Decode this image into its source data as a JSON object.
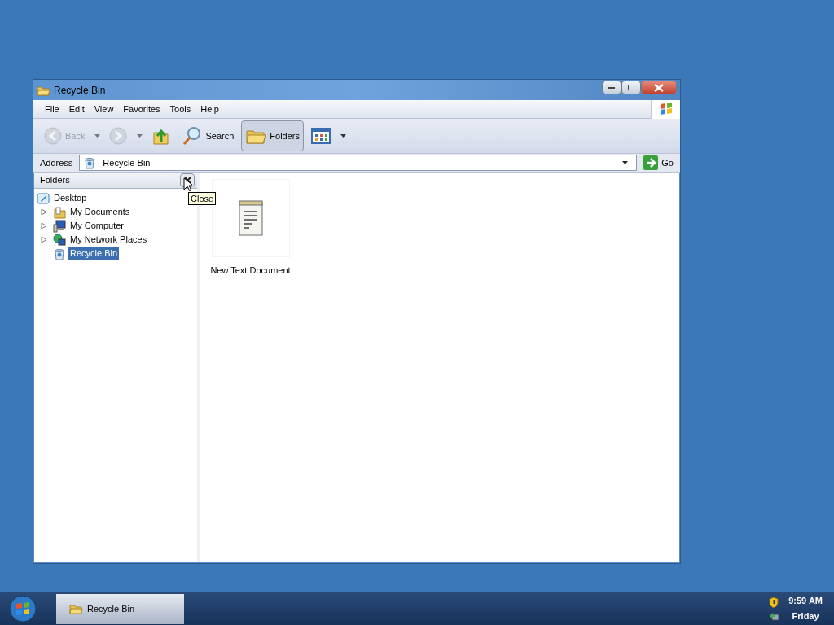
{
  "window": {
    "title": "Recycle Bin"
  },
  "menu": [
    "File",
    "Edit",
    "View",
    "Favorites",
    "Tools",
    "Help"
  ],
  "toolbar": [
    {
      "kind": "back",
      "label": "Back",
      "disabled": true,
      "pressed": false
    },
    {
      "kind": "forward",
      "disabled": true,
      "pressed": false
    },
    {
      "kind": "up",
      "disabled": false,
      "pressed": false
    },
    {
      "kind": "search",
      "label": "Search",
      "disabled": false,
      "pressed": false
    },
    {
      "kind": "folders",
      "label": "Folders",
      "disabled": false,
      "pressed": true
    },
    {
      "kind": "views",
      "disabled": false,
      "pressed": false
    }
  ],
  "address": {
    "label": "Address",
    "value": "Recycle Bin",
    "go": "Go"
  },
  "folders_pane": {
    "title": "Folders",
    "close_tooltip": "Close",
    "tree": [
      {
        "label": "Desktop",
        "kind": "desktop",
        "selected": false,
        "children": [
          {
            "label": "My Documents",
            "kind": "documents",
            "expandable": true,
            "selected": false
          },
          {
            "label": "My Computer",
            "kind": "computer",
            "expandable": true,
            "selected": false
          },
          {
            "label": "My Network Places",
            "kind": "network",
            "expandable": true,
            "selected": false
          },
          {
            "label": "Recycle Bin",
            "kind": "recycle",
            "expandable": false,
            "selected": true
          }
        ]
      }
    ]
  },
  "files": [
    {
      "name": "New Text Document",
      "kind": "text"
    }
  ],
  "taskbar": {
    "tasks": [
      {
        "label": "Recycle Bin",
        "active": true
      }
    ],
    "time": "9:59 AM",
    "day": "Friday"
  }
}
